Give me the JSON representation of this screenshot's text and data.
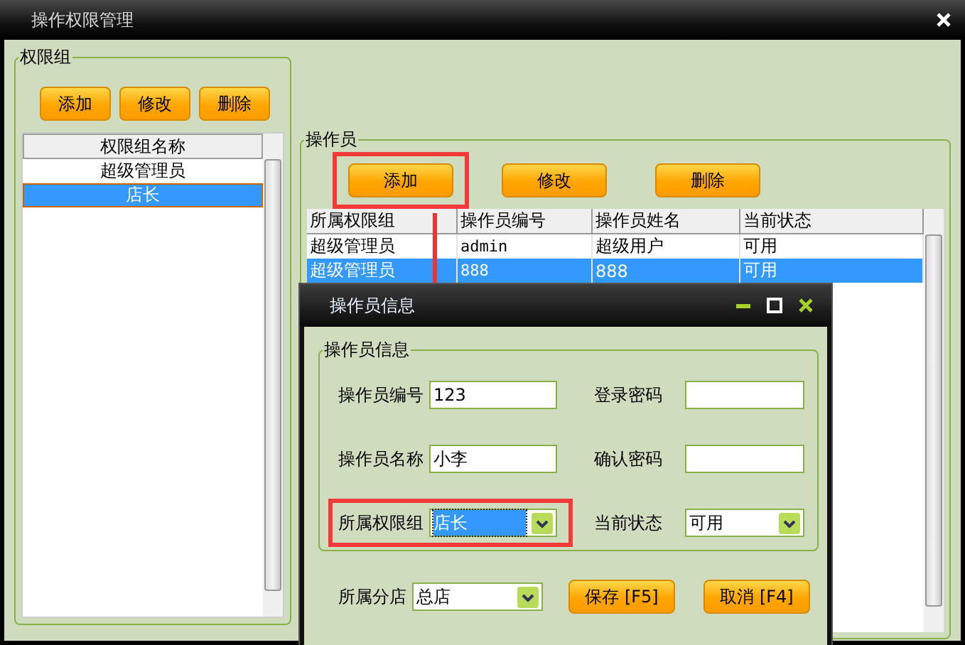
{
  "window": {
    "title": "操作权限管理"
  },
  "permission_group": {
    "title": "权限组",
    "buttons": [
      "添加",
      "修改",
      "删除"
    ],
    "list": {
      "header": "权限组名称",
      "items": [
        {
          "label": "超级管理员",
          "selected": false
        },
        {
          "label": "店长",
          "selected": true
        }
      ]
    }
  },
  "operators": {
    "title": "操作员",
    "buttons": [
      {
        "label": "添加",
        "highlighted": true
      },
      {
        "label": "修改",
        "highlighted": false
      },
      {
        "label": "删除",
        "highlighted": false
      }
    ],
    "table": {
      "columns": [
        "所属权限组",
        "操作员编号",
        "操作员姓名",
        "当前状态"
      ],
      "rows": [
        {
          "cells": [
            "超级管理员",
            "admin",
            "超级用户",
            "可用"
          ],
          "selected": false
        },
        {
          "cells": [
            "超级管理员",
            "888",
            "888",
            "可用"
          ],
          "selected": true
        }
      ]
    }
  },
  "dialog": {
    "title": "操作员信息",
    "group_title": "操作员信息",
    "fields": [
      {
        "label": "操作员编号",
        "kind": "text",
        "value": "123",
        "highlighted": false
      },
      {
        "label": "登录密码",
        "kind": "password",
        "highlighted": false
      },
      {
        "label": "操作员名称",
        "kind": "text",
        "value": "小李",
        "highlighted": false
      },
      {
        "label": "确认密码",
        "kind": "password",
        "highlighted": false
      },
      {
        "label": "所属权限组",
        "kind": "select",
        "value": "店长",
        "highlighted": true,
        "value_selected": true
      },
      {
        "label": "当前状态",
        "kind": "select",
        "value": "可用",
        "highlighted": false,
        "value_selected": false
      }
    ],
    "branch": {
      "label": "所属分店",
      "value": "总店"
    },
    "buttons": [
      "保存 [F5]",
      "取消 [F4]"
    ]
  }
}
